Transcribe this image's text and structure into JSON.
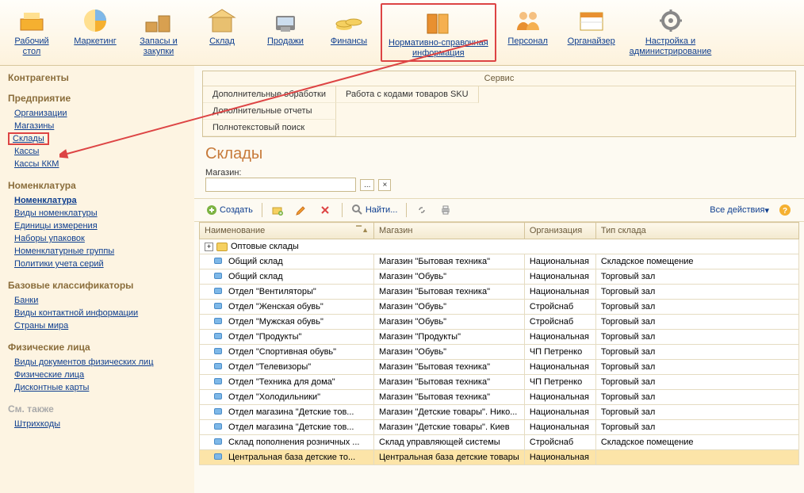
{
  "toolbar": [
    {
      "label": "Рабочий\nстол",
      "name": "desktop"
    },
    {
      "label": "Маркетинг",
      "name": "marketing"
    },
    {
      "label": "Запасы и\nзакупки",
      "name": "inventory"
    },
    {
      "label": "Склад",
      "name": "warehouse"
    },
    {
      "label": "Продажи",
      "name": "sales"
    },
    {
      "label": "Финансы",
      "name": "finance"
    },
    {
      "label": "Нормативно-справочная\nинформация",
      "name": "reference",
      "highlight": true
    },
    {
      "label": "Персонал",
      "name": "personnel"
    },
    {
      "label": "Органайзер",
      "name": "organizer"
    },
    {
      "label": "Настройка и\nадминистрирование",
      "name": "admin"
    }
  ],
  "sidebar": {
    "groups": [
      {
        "header": "Контрагенты",
        "items": []
      },
      {
        "header": "Предприятие",
        "items": [
          {
            "label": "Организации"
          },
          {
            "label": "Магазины"
          },
          {
            "label": "Склады",
            "highlight": true
          },
          {
            "label": "Кассы"
          },
          {
            "label": "Кассы ККМ"
          }
        ]
      },
      {
        "header": "Номенклатура",
        "items": [
          {
            "label": "Номенклатура",
            "bold": true
          },
          {
            "label": "Виды номенклатуры"
          },
          {
            "label": "Единицы измерения"
          },
          {
            "label": "Наборы упаковок"
          },
          {
            "label": "Номенклатурные группы"
          },
          {
            "label": "Политики учета серий"
          }
        ]
      },
      {
        "header": "Базовые классификаторы",
        "items": [
          {
            "label": "Банки"
          },
          {
            "label": "Виды контактной информации"
          },
          {
            "label": "Страны мира"
          }
        ]
      },
      {
        "header": "Физические лица",
        "items": [
          {
            "label": "Виды документов физических лиц"
          },
          {
            "label": "Физические лица"
          },
          {
            "label": "Дисконтные карты"
          }
        ]
      },
      {
        "header": "См. также",
        "cls": "sm-also",
        "items": [
          {
            "label": "Штрихкоды"
          }
        ]
      }
    ]
  },
  "service": {
    "title": "Сервис",
    "col1": [
      "Дополнительные обработки",
      "Дополнительные отчеты",
      "Полнотекстовый поиск"
    ],
    "col2": [
      "Работа с кодами товаров SKU"
    ]
  },
  "page": {
    "title": "Склады",
    "filter_label": "Магазин:",
    "filter_btn": "...",
    "filter_clear": "×"
  },
  "actions": {
    "create": "Создать",
    "find": "Найти...",
    "all": "Все действия"
  },
  "grid": {
    "columns": [
      "Наименование",
      "Магазин",
      "Организация",
      "Тип склада"
    ],
    "folder_row": {
      "label": "Оптовые склады"
    },
    "rows": [
      {
        "name": "Общий склад",
        "shop": "Магазин \"Бытовая техника\"",
        "org": "Национальная",
        "type": "Складское помещение"
      },
      {
        "name": "Общий склад",
        "shop": "Магазин \"Обувь\"",
        "org": "Национальная",
        "type": "Торговый зал"
      },
      {
        "name": "Отдел \"Вентиляторы\"",
        "shop": "Магазин \"Бытовая техника\"",
        "org": "Национальная",
        "type": "Торговый зал"
      },
      {
        "name": "Отдел \"Женская обувь\"",
        "shop": "Магазин \"Обувь\"",
        "org": "Стройснаб",
        "type": "Торговый зал"
      },
      {
        "name": "Отдел \"Мужская обувь\"",
        "shop": "Магазин \"Обувь\"",
        "org": "Стройснаб",
        "type": "Торговый зал"
      },
      {
        "name": "Отдел \"Продукты\"",
        "shop": "Магазин \"Продукты\"",
        "org": "Национальная",
        "type": "Торговый зал"
      },
      {
        "name": "Отдел \"Спортивная обувь\"",
        "shop": "Магазин \"Обувь\"",
        "org": "ЧП Петренко",
        "type": "Торговый зал"
      },
      {
        "name": "Отдел \"Телевизоры\"",
        "shop": "Магазин \"Бытовая техника\"",
        "org": "Национальная",
        "type": "Торговый зал"
      },
      {
        "name": "Отдел \"Техника для дома\"",
        "shop": "Магазин \"Бытовая техника\"",
        "org": "ЧП Петренко",
        "type": "Торговый зал"
      },
      {
        "name": "Отдел \"Холодильники\"",
        "shop": "Магазин \"Бытовая техника\"",
        "org": "Национальная",
        "type": "Торговый зал"
      },
      {
        "name": "Отдел магазина \"Детские тов...",
        "shop": "Магазин \"Детские товары\". Нико...",
        "org": "Национальная",
        "type": "Торговый зал"
      },
      {
        "name": "Отдел магазина \"Детские тов...",
        "shop": "Магазин \"Детские товары\". Киев",
        "org": "Национальная",
        "type": "Торговый зал"
      },
      {
        "name": "Склад пополнения розничных ...",
        "shop": "Склад управляющей системы",
        "org": "Стройснаб",
        "type": "Складское помещение"
      },
      {
        "name": "Центральная база детские то...",
        "shop": "Центральная база детские товары",
        "org": "Национальная",
        "type": "",
        "selected": true
      }
    ]
  }
}
